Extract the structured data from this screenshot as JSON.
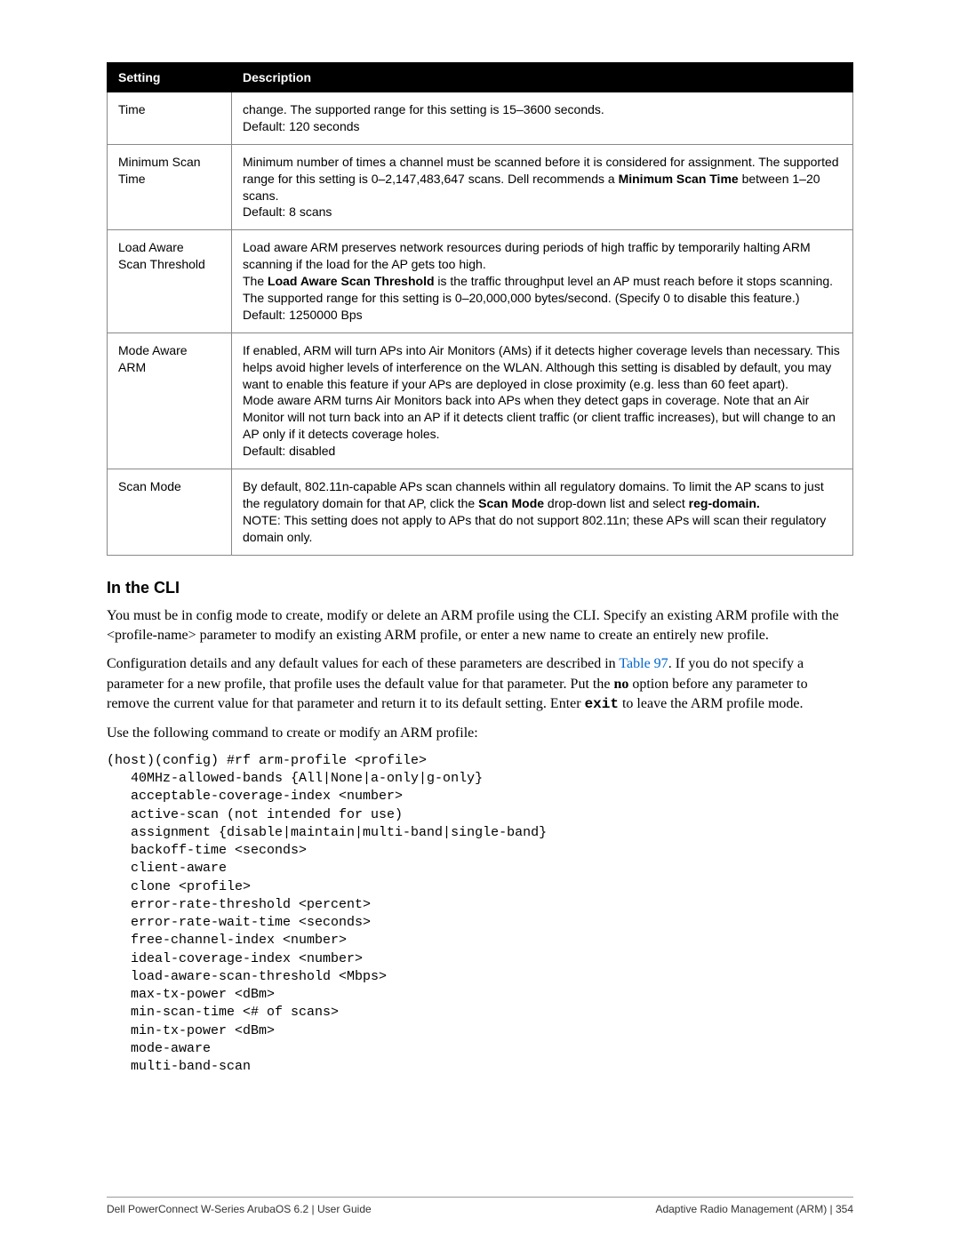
{
  "table": {
    "headers": {
      "setting": "Setting",
      "description": "Description"
    },
    "rows": [
      {
        "setting": "Time",
        "description": "change. The supported range for this setting is 15–3600 seconds.\nDefault: 120 seconds"
      },
      {
        "setting": "Minimum Scan\nTime",
        "desc_prefix": "Minimum number of times a channel must be scanned before it is considered for assignment. The supported range for this setting is 0–2,147,483,647 scans. Dell recommends a ",
        "desc_bold1": "Minimum Scan Time",
        "desc_suffix": " between 1–20 scans.\nDefault: 8 scans"
      },
      {
        "setting": "Load Aware\nScan Threshold",
        "desc_line1": "Load aware ARM preserves network resources during periods of high traffic by temporarily halting ARM scanning if the load for the AP gets too high.",
        "desc_line2_a": "The ",
        "desc_line2_bold": "Load Aware Scan Threshold",
        "desc_line2_b": " is the traffic throughput level an AP must reach before it stops scanning. The supported range for this setting is 0–20,000,000 bytes/second. (Specify 0 to disable this feature.)\nDefault: 1250000 Bps"
      },
      {
        "setting": "Mode Aware\nARM",
        "description": "If enabled, ARM will turn APs into Air Monitors (AMs) if it detects higher coverage levels than necessary. This helps avoid higher levels of interference on the WLAN. Although this setting is disabled by default, you may want to enable this feature if your APs are deployed in close proximity (e.g. less than 60 feet apart).\nMode aware ARM turns Air Monitors back into APs when they detect gaps in coverage. Note that an Air Monitor will not turn back into an AP if it detects client traffic (or client traffic increases), but will change to an AP only if it detects coverage holes.\nDefault: disabled"
      },
      {
        "setting": "Scan Mode",
        "desc_a": "By default, 802.11n-capable APs scan channels within all regulatory domains. To limit the AP scans to just the regulatory domain for that AP, click the ",
        "desc_bold1": "Scan Mode",
        "desc_b": " drop-down list and select ",
        "desc_bold2": "reg-domain.",
        "desc_c": "\nNOTE: This setting does not apply to APs that do not support 802.11n; these APs will scan their regulatory domain only."
      }
    ]
  },
  "cli": {
    "heading": "In the CLI",
    "para1": "You must be in config mode to create, modify or delete an ARM profile using the CLI. Specify an existing ARM profile with the <profile-name> parameter to modify an existing ARM profile, or enter a new name to create an entirely new profile.",
    "para2_a": "Configuration details and any default values for each of these parameters are described in ",
    "para2_link": "Table 97",
    "para2_b": ". If you do not specify a parameter for a new profile, that profile uses the default value for that parameter. Put the ",
    "para2_no": "no",
    "para2_c": " option before any parameter to remove the current value for that parameter and return it to its default setting. Enter ",
    "para2_exit": "exit",
    "para2_d": " to leave the ARM profile mode.",
    "para3": "Use the following command to create or modify an ARM profile:",
    "code": "(host)(config) #rf arm-profile <profile>\n   40MHz-allowed-bands {All|None|a-only|g-only}\n   acceptable-coverage-index <number>\n   active-scan (not intended for use)\n   assignment {disable|maintain|multi-band|single-band}\n   backoff-time <seconds>\n   client-aware\n   clone <profile>\n   error-rate-threshold <percent>\n   error-rate-wait-time <seconds>\n   free-channel-index <number>\n   ideal-coverage-index <number>\n   load-aware-scan-threshold <Mbps>\n   max-tx-power <dBm>\n   min-scan-time <# of scans>\n   min-tx-power <dBm>\n   mode-aware\n   multi-band-scan"
  },
  "footer": {
    "left": "Dell PowerConnect W-Series ArubaOS 6.2  |  User Guide",
    "right": "Adaptive Radio Management (ARM)  |  354"
  }
}
